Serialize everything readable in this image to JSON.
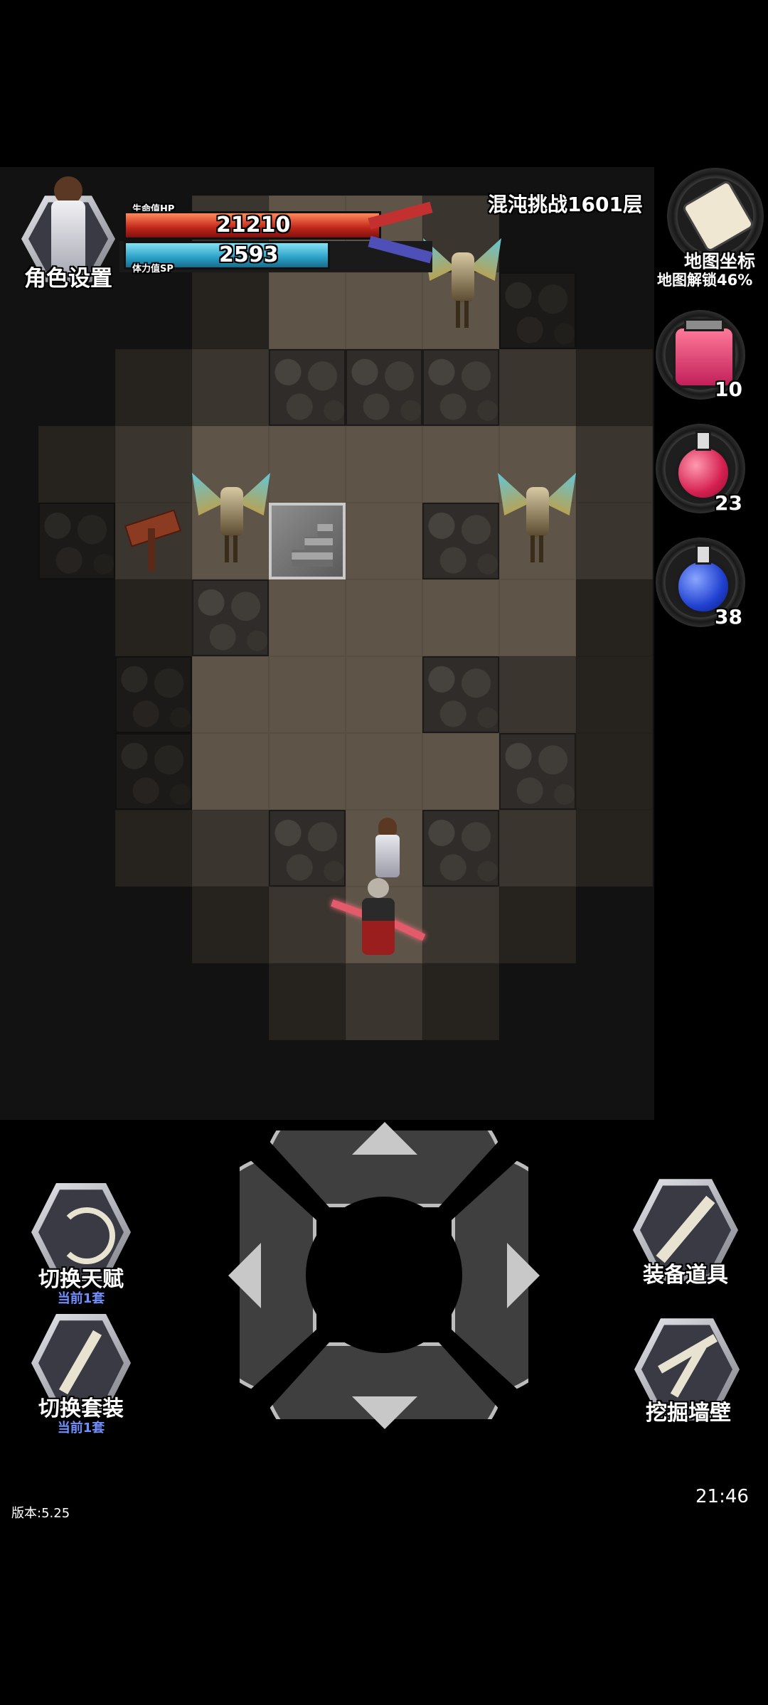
{
  "hud": {
    "character_button_label": "角色设置",
    "hp_label": "生命值HP",
    "hp_value": "21210",
    "hp_fraction": 1.0,
    "sp_label": "体力值SP",
    "sp_value": "2593",
    "sp_fraction": 0.8,
    "level_title": "混沌挑战1601层",
    "map_button_label": "地图坐标",
    "map_unlock_text": "地图解锁46%"
  },
  "items": [
    {
      "icon": "health-jar-icon",
      "count": "10",
      "color": "#d42050"
    },
    {
      "icon": "red-potion-icon",
      "count": "23",
      "color": "#d42050"
    },
    {
      "icon": "blue-potion-icon",
      "count": "38",
      "color": "#2040d0"
    }
  ],
  "controls": {
    "switch_talent_label": "切换天赋",
    "switch_talent_sub": "当前1套",
    "switch_outfit_label": "切换套装",
    "switch_outfit_sub": "当前1套",
    "equip_items_label": "装备道具",
    "dig_wall_label": "挖掘墙壁"
  },
  "footer": {
    "version": "版本:5.25",
    "clock": "21:46"
  },
  "colors": {
    "hp": "#c0271a",
    "sp": "#2aa0c6",
    "dpad": "#3f3f3f",
    "sublabel": "#6f8fff"
  }
}
